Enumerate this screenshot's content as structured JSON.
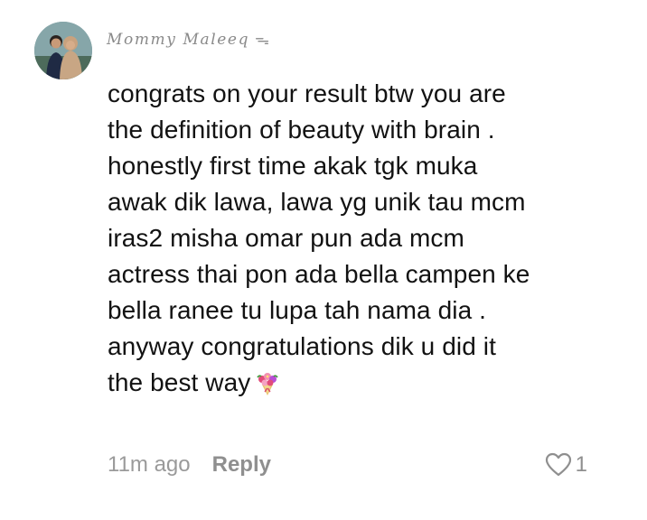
{
  "comment": {
    "author": "Mommy Maleeq",
    "author_badge_icon": "ribbon-bow-icon",
    "text_lines": [
      "congrats on your result btw you are",
      "the definition of beauty with brain .",
      "honestly first time akak tgk muka",
      "awak dik lawa, lawa yg unik tau mcm",
      "iras2 misha omar pun ada mcm",
      "actress thai pon ada bella campen ke",
      "bella ranee tu lupa tah nama dia .",
      "anyway congratulations dik u did it",
      "the best way"
    ],
    "end_emoji": "bouquet-icon",
    "timestamp": "11m ago",
    "reply_label": "Reply",
    "like_count": "1"
  },
  "colors": {
    "text": "#121212",
    "muted": "#8f8f8f",
    "background": "#ffffff"
  }
}
